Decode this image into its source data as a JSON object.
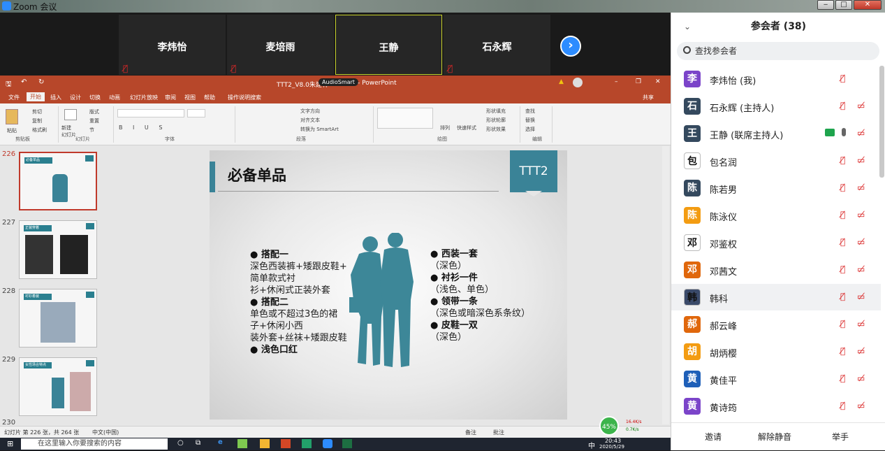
{
  "window": {
    "title": "Zoom 会议",
    "min_label": "‒",
    "max_label": "□",
    "close_label": "✕"
  },
  "video_strip": {
    "tiles": [
      {
        "name": "李炜怡",
        "muted_icon": "muted-mic-icon"
      },
      {
        "name": "麦培雨",
        "muted_icon": "muted-mic-icon"
      },
      {
        "name": "王静",
        "muted_icon": "none",
        "active": true
      },
      {
        "name": "石永辉",
        "muted_icon": "muted-mic-icon"
      }
    ],
    "next_label": "›"
  },
  "ppt": {
    "title": "TTT2_V8.0朱建林",
    "title_badge": "AudioSmart",
    "app": "- PowerPoint",
    "tabs": [
      "文件",
      "开始",
      "插入",
      "设计",
      "切换",
      "动画",
      "幻灯片放映",
      "审阅",
      "视图",
      "帮助",
      "操作说明搜索"
    ],
    "share": "共享",
    "ribbon_groups": [
      "剪贴板",
      "幻灯片",
      "字体",
      "段落",
      "绘图",
      "编辑"
    ],
    "ribbon_items": {
      "paste": "粘贴",
      "cut": "剪切",
      "copy": "复制",
      "format_painter": "格式刷",
      "new_slide": "新建\n幻灯片",
      "layout": "版式",
      "reset": "重置",
      "section": "节",
      "text_direction": "文字方向",
      "align_text": "对齐文本",
      "smartart": "转换为 SmartArt",
      "arrange": "排列",
      "quick_styles": "快速样式",
      "shape_fill": "形状填充",
      "shape_outline": "形状轮廓",
      "shape_effects": "形状效果",
      "find": "查找",
      "replace": "替换",
      "select": "选择"
    },
    "thumb_numbers": [
      "226",
      "227",
      "228",
      "229",
      "230"
    ],
    "thumb_titles": [
      "必备单品",
      "正装穿着",
      "衬衫着装",
      "女性场合特点"
    ],
    "slide": {
      "title": "必备单品",
      "badge": "TTT2",
      "left_lines": [
        {
          "text": "● 搭配一",
          "bold": true
        },
        {
          "text": "深色西装裤+矮跟皮鞋+",
          "bold": false
        },
        {
          "text": "简单款式衬",
          "bold": false
        },
        {
          "text": "衫+休闲式正装外套",
          "bold": false
        },
        {
          "text": "● 搭配二",
          "bold": true
        },
        {
          "text": "单色或不超过3色的裙",
          "bold": false
        },
        {
          "text": "子+休闲小西",
          "bold": false
        },
        {
          "text": "装外套+丝袜+矮跟皮鞋",
          "bold": false
        },
        {
          "text": "● 浅色口红",
          "bold": true
        }
      ],
      "right_lines": [
        {
          "text": "● 西装一套",
          "bold": true
        },
        {
          "text": "（深色）",
          "bold": false
        },
        {
          "text": "● 衬衫一件",
          "bold": true
        },
        {
          "text": "（浅色、单色）",
          "bold": false
        },
        {
          "text": "● 领带一条",
          "bold": true
        },
        {
          "text": "（深色或暗深色系条纹）",
          "bold": false
        },
        {
          "text": "● 皮鞋一双",
          "bold": true
        },
        {
          "text": "（深色）",
          "bold": false
        }
      ]
    },
    "status": {
      "slide_info": "幻灯片 第 226 张，共 264 张",
      "lang": "中文(中国)",
      "notes": "备注",
      "comments": "批注"
    },
    "network_widget": {
      "percent": "45%",
      "up": "16.4K/s",
      "down": "0.7K/s"
    }
  },
  "taskbar": {
    "search_placeholder": "在这里输入你要搜索的内容",
    "time": "20:43",
    "date": "2020/5/29",
    "ime": "中"
  },
  "participants": {
    "header": "参会者 (38)",
    "search_placeholder": "查找参会者",
    "list": [
      {
        "avatar": "李",
        "color": "#7b44c9",
        "name": "李炜怡 (我)",
        "mute": true,
        "video_off": false
      },
      {
        "avatar": "石",
        "color": "#34495e",
        "name": "石永辉 (主持人)",
        "mute": true,
        "video_off": true
      },
      {
        "avatar": "王",
        "color": "#34495e",
        "name": "王静 (联席主持人)",
        "mute": false,
        "video_off": true,
        "sharing": true
      },
      {
        "avatar": "包",
        "color": "#ffffff",
        "name": "包名润",
        "mute": true,
        "video_off": true,
        "photo": true
      },
      {
        "avatar": "陈",
        "color": "#34495e",
        "name": "陈若男",
        "mute": true,
        "video_off": true
      },
      {
        "avatar": "陈",
        "color": "#f39c12",
        "name": "陈泳仪",
        "mute": true,
        "video_off": true
      },
      {
        "avatar": "邓",
        "color": "#ffffff",
        "name": "邓鉴权",
        "mute": true,
        "video_off": true,
        "photo": true
      },
      {
        "avatar": "邓",
        "color": "#e0670c",
        "name": "邓茜文",
        "mute": true,
        "video_off": true
      },
      {
        "avatar": "韩",
        "color": "#3a4a6a",
        "name": "韩科",
        "mute": true,
        "video_off": true,
        "photo": true,
        "highlight": true
      },
      {
        "avatar": "郝",
        "color": "#e0670c",
        "name": "郝云峰",
        "mute": true,
        "video_off": true
      },
      {
        "avatar": "胡",
        "color": "#f39c12",
        "name": "胡炳樱",
        "mute": true,
        "video_off": true
      },
      {
        "avatar": "黄",
        "color": "#1e5fb8",
        "name": "黄佳平",
        "mute": true,
        "video_off": true
      },
      {
        "avatar": "黄",
        "color": "#7b44c9",
        "name": "黄诗筠",
        "mute": true,
        "video_off": true
      }
    ],
    "footer": {
      "invite": "邀请",
      "unmute": "解除静音",
      "raise_hand": "举手"
    }
  }
}
